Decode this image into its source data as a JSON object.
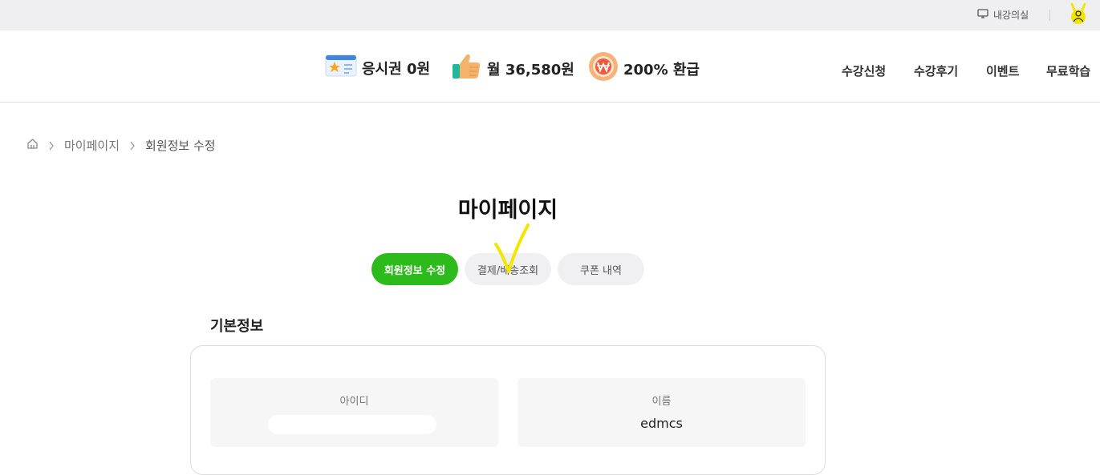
{
  "topbar": {
    "classroom_label": "내강의실"
  },
  "header": {
    "promos": [
      {
        "label": "응시권 0원",
        "icon": "ticket-icon"
      },
      {
        "label": "월 36,580원",
        "icon": "thumbs-up-icon"
      },
      {
        "label": "200% 환급",
        "icon": "won-coin-icon"
      }
    ],
    "nav": [
      {
        "label": "수강신청"
      },
      {
        "label": "수강후기"
      },
      {
        "label": "이벤트"
      },
      {
        "label": "무료학습"
      }
    ]
  },
  "breadcrumb": {
    "home_icon": "home-icon",
    "items": [
      "마이페이지",
      "회원정보 수정"
    ]
  },
  "page": {
    "title": "마이페이지"
  },
  "tabs": [
    {
      "label": "회원정보 수정",
      "active": true
    },
    {
      "label": "결제/배송조회",
      "active": false
    },
    {
      "label": "쿠폰 내역",
      "active": false
    }
  ],
  "basic_info": {
    "title": "기본정보",
    "id_label": "아이디",
    "id_value": "",
    "name_label": "이름",
    "name_value": "edmcs"
  },
  "colors": {
    "accent_green": "#2cbb1a",
    "tab_inactive": "#f0f0f2",
    "field_bg": "#f6f6f7",
    "annotation_yellow": "#f2e600"
  }
}
